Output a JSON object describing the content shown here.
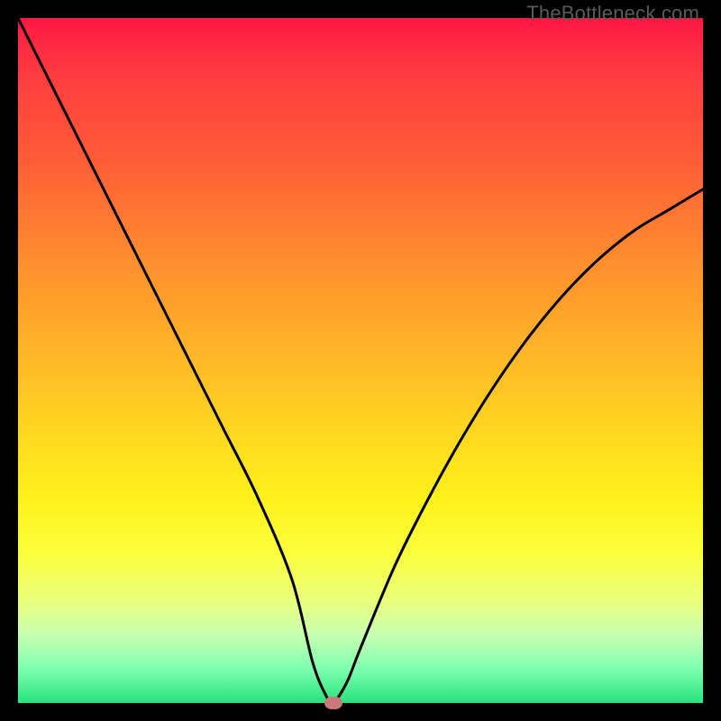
{
  "watermark": "TheBottleneck.com",
  "colors": {
    "frame": "#000000",
    "gradient_top": "#ff1744",
    "gradient_mid": "#ffd61f",
    "gradient_bottom": "#27e37a",
    "curve": "#000000",
    "marker": "#c97a78"
  },
  "chart_data": {
    "type": "line",
    "title": "",
    "xlabel": "",
    "ylabel": "",
    "xlim": [
      0,
      100
    ],
    "ylim": [
      0,
      100
    ],
    "annotations": [],
    "series": [
      {
        "name": "bottleneck-curve",
        "x": [
          0,
          5,
          10,
          15,
          20,
          25,
          30,
          35,
          40,
          43,
          45,
          46,
          48,
          50,
          55,
          60,
          65,
          70,
          75,
          80,
          85,
          90,
          95,
          100
        ],
        "y": [
          100,
          90,
          80,
          70,
          60,
          50,
          40,
          30,
          18,
          6,
          1,
          0,
          3,
          8,
          20,
          30,
          39,
          47,
          54,
          60,
          65,
          69,
          72,
          75
        ]
      }
    ],
    "minimum_marker": {
      "x": 46,
      "y": 0
    }
  }
}
